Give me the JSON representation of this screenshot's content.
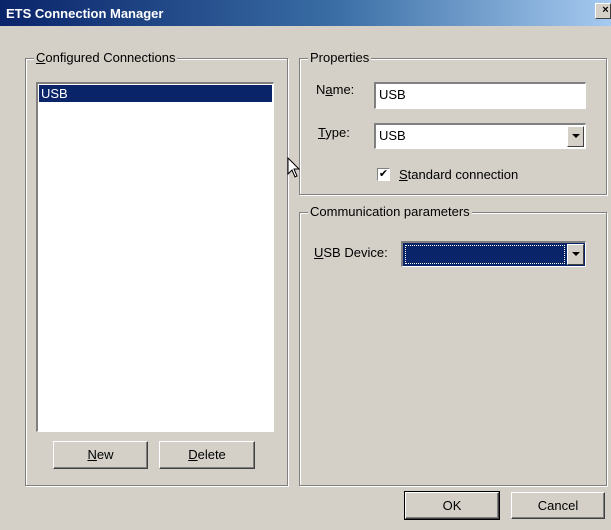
{
  "window": {
    "title": "ETS Connection Manager",
    "close_glyph": "×"
  },
  "configured": {
    "legend_first": "C",
    "legend_rest": "onfigured Connections",
    "items": [
      {
        "label": "USB",
        "selected": true
      }
    ]
  },
  "buttons": {
    "new_u": "N",
    "new_rest": "ew",
    "delete_u": "D",
    "delete_rest": "elete",
    "ok": "OK",
    "cancel": "Cancel"
  },
  "properties": {
    "legend": "Properties",
    "name_label_pre": "N",
    "name_label_u": "a",
    "name_label_post": "me:",
    "name_value": "USB",
    "type_label_u": "T",
    "type_label_post": "ype:",
    "type_value": "USB",
    "standard_checked": "✔",
    "standard_u": "S",
    "standard_rest": "tandard connection"
  },
  "comm": {
    "legend": "Communication parameters",
    "usb_label_u": "U",
    "usb_label_post": "SB Device:",
    "usb_value": ""
  },
  "colors": {
    "selection": "#0a246a",
    "face": "#d4d0c8"
  }
}
